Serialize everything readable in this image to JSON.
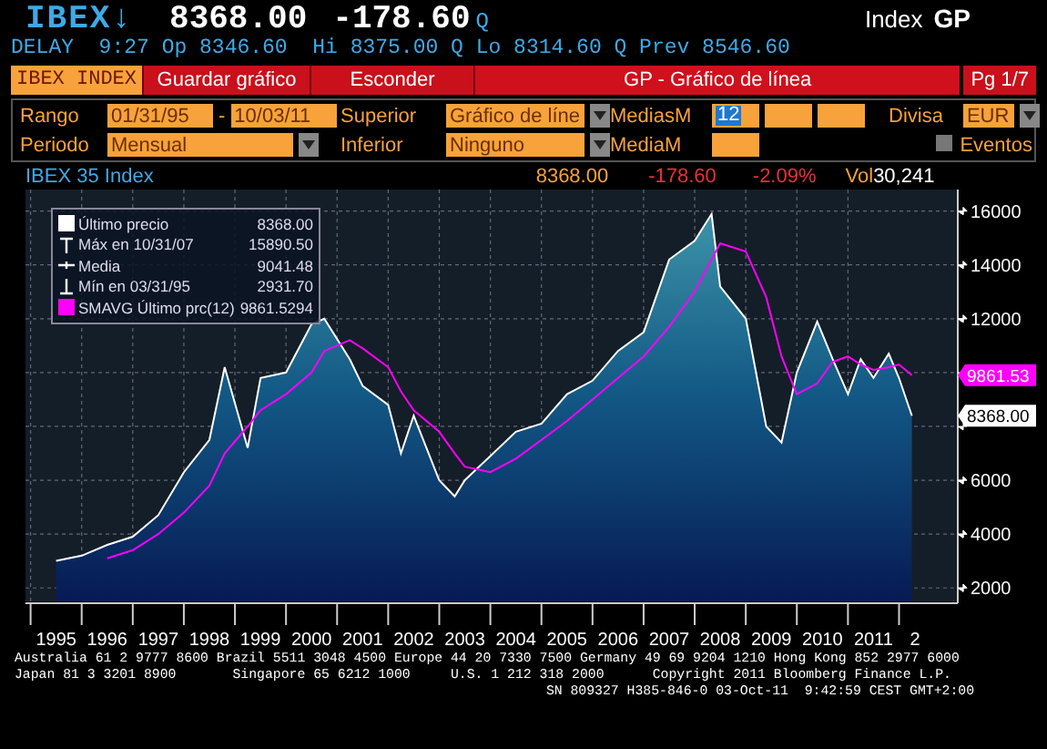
{
  "quote": {
    "ticker": "IBEX",
    "arrow": "↓",
    "price": "8368.00",
    "change": "-178.60",
    "source": "Q",
    "type": "Index",
    "function": "GP"
  },
  "delay_line": "DELAY  9:27 Op 8346.60  Hi 8375.00 Q Lo 8314.60 Q Prev 8546.60",
  "toolbar": {
    "security": "IBEX INDEX",
    "buttons": [
      "Guardar gráfico",
      "Esconder"
    ],
    "title": "GP - Gráfico de línea",
    "page": "Pg 1/7"
  },
  "range": {
    "label": "Rango",
    "start": "01/31/95",
    "separator": "-",
    "end": "10/03/11"
  },
  "period": {
    "label": "Periodo",
    "value": "Mensual"
  },
  "upper": {
    "label": "Superior",
    "value": "Gráfico de líne"
  },
  "lower": {
    "label": "Inferior",
    "value": "Ninguno"
  },
  "moving_averages": {
    "label": "MediasM",
    "fields": [
      {
        "value": "12",
        "selected": true
      },
      {
        "selected": false
      },
      {
        "selected": false
      }
    ]
  },
  "average": {
    "label": "MediaM"
  },
  "currency": {
    "label": "Divisa",
    "value": "EUR"
  },
  "events": {
    "label": "Eventos",
    "checked": false
  },
  "info": {
    "name": "IBEX 35 Index",
    "last": "8368.00",
    "change": "-178.60",
    "percent": "-2.09%",
    "vol_label": "Vol",
    "vol": "30,241"
  },
  "chart": {
    "legend": [
      {
        "kind": "square",
        "value": "8368.00",
        "color": "#ffffff"
      },
      {
        "kind": "max",
        "label": "Máx en 10/31/07",
        "value": "15890.50"
      },
      {
        "kind": "mean",
        "label": "Media",
        "value": "9041.48"
      },
      {
        "kind": "min",
        "label": "Mín en 03/31/95",
        "value": "2931.70"
      },
      {
        "kind": "square",
        "value": "9861.5294",
        "color": "#ff00ff"
      }
    ],
    "tags": [
      {
        "kind": "average",
        "label": "9861.53",
        "color": "#ff00ff"
      },
      {
        "kind": "price",
        "label": "8368.00",
        "color": "#ffffff"
      }
    ],
    "x_axis_cut_label": "2",
    "chart_data": {
      "type": "area",
      "grid": true,
      "x": [
        1995.0,
        1995.5,
        1996.0,
        1996.5,
        1997.0,
        1997.5,
        1998.0,
        1998.3,
        1998.75,
        1999.0,
        1999.5,
        2000.0,
        2000.25,
        2000.75,
        2001.0,
        2001.5,
        2001.75,
        2002.0,
        2002.5,
        2002.8,
        2003.0,
        2003.5,
        2004.0,
        2004.5,
        2005.0,
        2005.5,
        2006.0,
        2006.5,
        2007.0,
        2007.5,
        2007.83,
        2008.0,
        2008.5,
        2008.9,
        2009.2,
        2009.5,
        2009.9,
        2010.2,
        2010.5,
        2010.75,
        2011.0,
        2011.3,
        2011.5,
        2011.75
      ],
      "series": [
        {
          "name": "Último precio",
          "color": "#ffffff",
          "values": [
            3000,
            3200,
            3600,
            3900,
            4700,
            6300,
            7500,
            10200,
            7200,
            9800,
            10000,
            11800,
            12000,
            10500,
            9500,
            8800,
            7000,
            8400,
            6000,
            5400,
            6000,
            6900,
            7800,
            8100,
            9200,
            9700,
            10800,
            11500,
            14200,
            14900,
            15890,
            13200,
            12000,
            8000,
            7400,
            10000,
            11900,
            10500,
            9200,
            10500,
            9800,
            10700,
            9800,
            8400
          ]
        },
        {
          "name": "SMAVG Último prc(12)",
          "type": "line",
          "color": "#ff00ff",
          "values": [
            null,
            null,
            3100,
            3400,
            4000,
            4800,
            5800,
            7000,
            8000,
            8600,
            9200,
            10000,
            10800,
            11200,
            10900,
            10200,
            9300,
            8600,
            7800,
            7000,
            6500,
            6300,
            6800,
            7500,
            8200,
            9000,
            9800,
            10600,
            11700,
            13000,
            14200,
            14800,
            14500,
            12800,
            10600,
            9200,
            9600,
            10400,
            10600,
            10300,
            10100,
            10200,
            10300,
            9900
          ]
        }
      ],
      "xlim": [
        1994.4,
        2012.65
      ],
      "ylim": [
        1500,
        16800
      ],
      "xticks": [
        1995,
        1996,
        1997,
        1998,
        1999,
        2000,
        2001,
        2002,
        2003,
        2004,
        2005,
        2006,
        2007,
        2008,
        2009,
        2010,
        2011
      ],
      "yticks": [
        2000,
        4000,
        6000,
        12000,
        14000,
        16000
      ]
    }
  },
  "footer": [
    "Australia 61 2 9777 8600 Brazil 5511 3048 4500 Europe 44 20 7330 7500 Germany 49 69 9204 1210 Hong Kong 852 2977 6000",
    "Japan 81 3 3201 8900       Singapore 65 6212 1000     U.S. 1 212 318 2000      Copyright 2011 Bloomberg Finance L.P.",
    "SN 809327 H385-846-0 03-Oct-11  9:42:59 CEST GMT+2:00"
  ]
}
